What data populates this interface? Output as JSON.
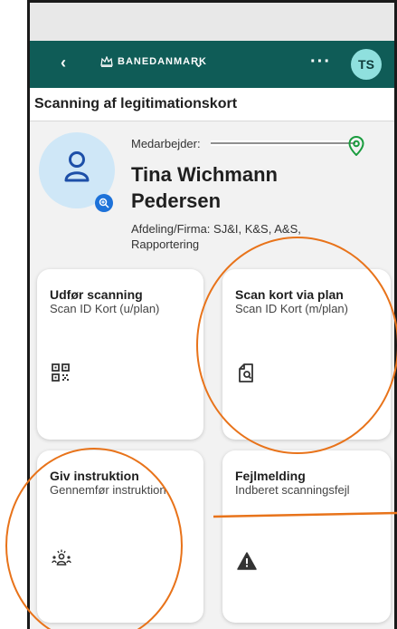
{
  "app": {
    "back_icon": "chevron-left-icon",
    "logo_text": "BANEDANMARK",
    "dropdown_icon": "chevron-down-icon",
    "more_icon": "more-dots-icon",
    "avatar_initials": "TS",
    "brand_color": "#0f5c57"
  },
  "page": {
    "title": "Scanning af legitimationskort"
  },
  "profile": {
    "employee_label": "Medarbejder:",
    "name": "Tina Wichmann Pedersen",
    "department": "Afdeling/Firma: SJ&I, K&S, A&S, Rapportering"
  },
  "cards": [
    {
      "title": "Udfør scanning",
      "subtitle": "Scan ID Kort (u/plan)",
      "icon": "qr-code-icon"
    },
    {
      "title": "Scan kort via plan",
      "subtitle": "Scan ID Kort (m/plan)",
      "icon": "document-search-icon"
    },
    {
      "title": "Giv instruktion",
      "subtitle": "Gennemfør instruktion",
      "icon": "group-instruction-icon"
    },
    {
      "title": "Fejlmelding",
      "subtitle": "Indberet scanningsfejl",
      "icon": "warning-icon"
    }
  ]
}
